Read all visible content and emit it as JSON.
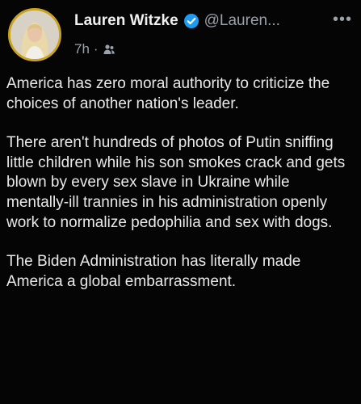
{
  "post": {
    "author": {
      "name": "Lauren Witzke",
      "handle": "@Lauren...",
      "verified": true
    },
    "time": "7h",
    "separator": "·",
    "icons": {
      "verified": "verified-badge-icon",
      "audience": "friends-audience-icon",
      "more": "more-options-icon"
    },
    "more_label": "•••",
    "paragraphs": [
      "America has zero moral authority to criticize the choices of another nation's leader.",
      "There aren't hundreds of photos of Putin sniffing little children while his son smokes crack and gets blown by every sex slave in Ukraine while mentally-ill trannies in his administration openly work to normalize pedophilia and sex with dogs.",
      "The Biden Administration has literally made America a global embarrassment."
    ]
  },
  "colors": {
    "background": "#050506",
    "text": "#e9e9e9",
    "secondary": "#9aa1a8",
    "verified": "#1d9bf0",
    "avatar_ring": "#c9a21f"
  }
}
